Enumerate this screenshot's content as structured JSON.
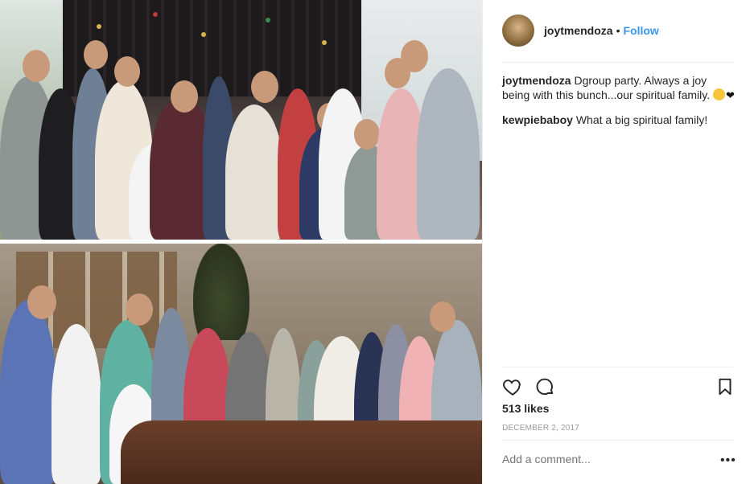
{
  "post": {
    "username": "joytmendoza",
    "separator": "•",
    "follow_label": "Follow",
    "likes": "513 likes",
    "date": "DECEMBER 2, 2017",
    "add_comment_placeholder": "Add a comment...",
    "more_label": "•••"
  },
  "comments": [
    {
      "user": "joytmendoza",
      "text": "Dgroup party. Always a joy being with this bunch...our spiritual family.",
      "emoji": [
        "hugging-face",
        "black-heart"
      ]
    },
    {
      "user": "kewpiebaboy",
      "text": "What a big spiritual family!"
    }
  ],
  "colors": {
    "follow_blue": "#3897f0",
    "text": "#262626",
    "muted": "#999999",
    "divider": "#efefef"
  },
  "icons": [
    "heart-icon",
    "comment-icon",
    "bookmark-icon",
    "more-icon"
  ]
}
